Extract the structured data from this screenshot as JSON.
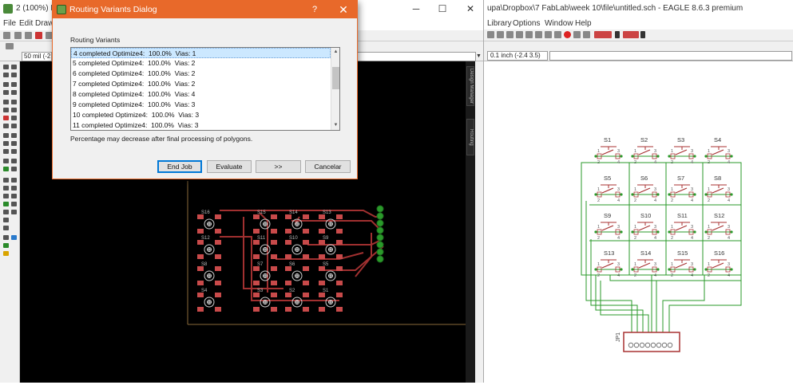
{
  "board_window": {
    "title": "2 (100%) Bo",
    "menu": [
      "File",
      "Edit",
      "Draw"
    ],
    "grid_text": "50 mil (-2",
    "side_tabs": [
      "Design Manager",
      "Routing"
    ]
  },
  "schematic_window": {
    "title": "upa\\Dropbox\\7 FabLab\\week 10\\file\\untitled.sch - EAGLE 8.6.3 premium",
    "menu": [
      "Library",
      "Options",
      "Window",
      "Help"
    ],
    "grid_text": "0.1 inch (-2.4 3.5)",
    "switches": [
      "S1",
      "S2",
      "S3",
      "S4",
      "S5",
      "S6",
      "S7",
      "S8",
      "S9",
      "S10",
      "S11",
      "S12",
      "S13",
      "S14",
      "S15",
      "S16"
    ],
    "pin_labels": [
      "1",
      "2",
      "3",
      "4"
    ],
    "connector_label": "JP1"
  },
  "board_components": [
    "S16",
    "S15",
    "S14",
    "S13",
    "S12",
    "S11",
    "S10",
    "S9",
    "S8",
    "S7",
    "S6",
    "S5",
    "S4",
    "S3",
    "S2",
    "S1"
  ],
  "dialog": {
    "title": "Routing Variants Dialog",
    "help": "?",
    "close": "✕",
    "group_label": "Routing Variants",
    "variants": [
      "4 completed Optimize4:  100.0%  Vias: 1",
      "5 completed Optimize4:  100.0%  Vias: 2",
      "6 completed Optimize4:  100.0%  Vias: 2",
      "7 completed Optimize4:  100.0%  Vias: 2",
      "8 completed Optimize4:  100.0%  Vias: 4",
      "9 completed Optimize4:  100.0%  Vias: 3",
      "10 completed Optimize4:  100.0%  Vias: 3",
      "11 completed Optimize4:  100.0%  Vias: 3"
    ],
    "selected_index": 0,
    "note": "Percentage may decrease after final processing of polygons.",
    "buttons": {
      "end_job": "End Job",
      "evaluate": "Evaluate",
      "next": ">>",
      "cancel": "Cancelar"
    }
  },
  "colors": {
    "dialog_accent": "#e8692a",
    "selection": "#cce8ff",
    "pcb_pad": "#c84a4a",
    "pcb_trace": "#a03030",
    "schematic_net": "#2a9a2a",
    "schematic_part": "#a83232"
  }
}
